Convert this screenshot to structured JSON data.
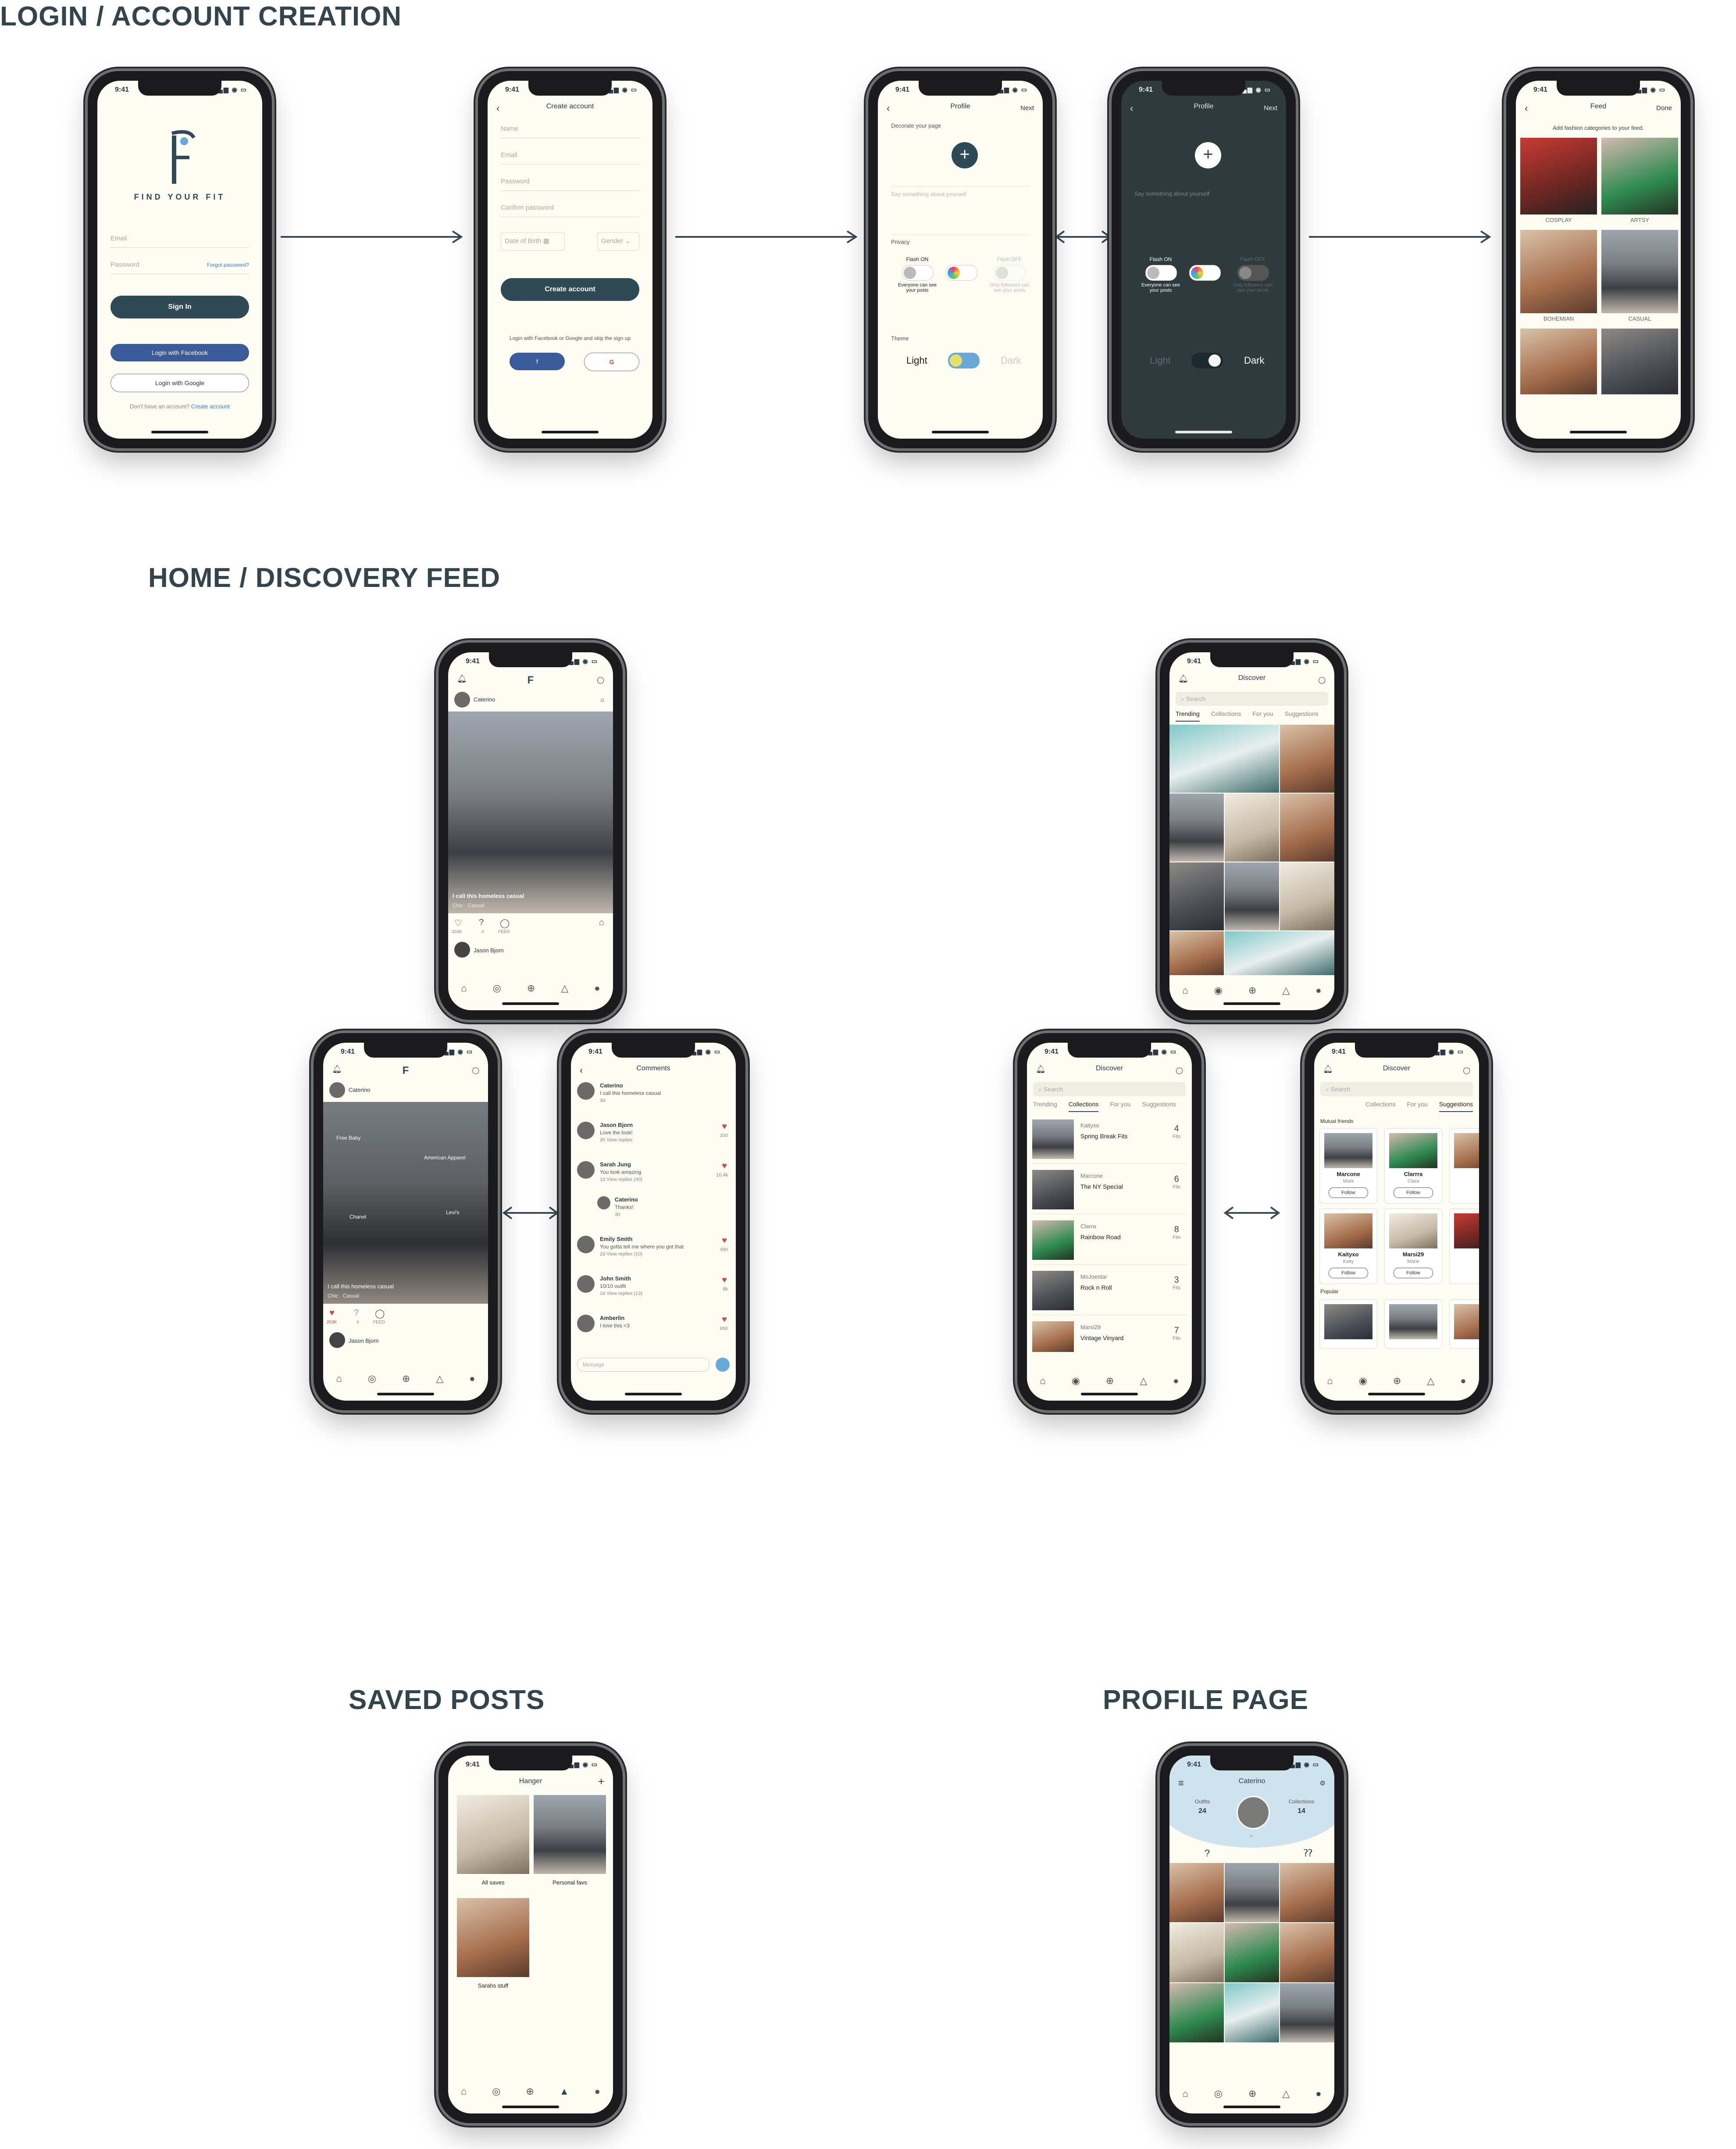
{
  "sections": {
    "login": "LOGIN / ACCOUNT CREATION",
    "home": "HOME / DISCOVERY FEED",
    "saved": "SAVED POSTS",
    "profile": "PROFILE PAGE"
  },
  "status_time": "9:41",
  "login": {
    "brand": "FIND YOUR FIT",
    "email_ph": "Email",
    "password_ph": "Password",
    "forgot": "Forgot password?",
    "sign_in": "Sign In",
    "facebook": "Login with Facebook",
    "google": "Login with Google",
    "no_account": "Don't have an account?",
    "create_link": "Create account"
  },
  "create": {
    "title": "Create account",
    "name": "Name",
    "email": "Email",
    "password": "Password",
    "confirm": "Confirm password",
    "dob": "Date of Birth",
    "gender": "Gender",
    "button": "Create account",
    "social_text": "Login with Facebook or Google and skip the sign up"
  },
  "profile_setup": {
    "title": "Profile",
    "next": "Next",
    "decorate": "Decorate your page",
    "bio_ph": "Say something about yourself",
    "privacy": "Privacy",
    "flash_on": "Flash ON",
    "flash_on_desc": "Everyone can see your posts",
    "flash_off": "Flash OFF",
    "flash_off_desc": "Only followers can see your posts",
    "theme": "Theme",
    "light": "Light",
    "dark": "Dark"
  },
  "feed_setup": {
    "title": "Feed",
    "done": "Done",
    "subtitle": "Add fashion categories to your feed.",
    "categories": [
      "COSPLAY",
      "ARTSY",
      "BOHEMIAN",
      "CASUAL"
    ]
  },
  "home": {
    "user": "Caterino",
    "caption": "I call this homeless casual",
    "tags": "Chic · Casual",
    "likes": "203K",
    "hangs": "4",
    "comments": "FEED",
    "next_user": "Jason Bjorn",
    "tag_labels": [
      "Free Baby",
      "American Apparel",
      "Chanel",
      "Levi's"
    ]
  },
  "comments": {
    "title": "Comments",
    "message_ph": "Message",
    "items": [
      {
        "name": "Caterino",
        "text": "I call this homeless casual",
        "meta": "3d",
        "count": ""
      },
      {
        "name": "Jason Bjorn",
        "text": "Love the look!",
        "meta": "3h  View replies",
        "count": "200"
      },
      {
        "name": "Sarah Jung",
        "text": "You look amazing",
        "meta": "1d  View replies (40)",
        "count": "10.4k"
      },
      {
        "name": "Caterino",
        "text": "Thanks!",
        "meta": "3h",
        "count": ""
      },
      {
        "name": "Emily Smith",
        "text": "You gotta tell me where you got that",
        "meta": "2d  View replies (10)",
        "count": "490"
      },
      {
        "name": "John Smith",
        "text": "10/10 outfit",
        "meta": "2d  View replies (13)",
        "count": "8k"
      },
      {
        "name": "Amberlin",
        "text": "I love this <3",
        "meta": "",
        "count": "690"
      }
    ]
  },
  "discover": {
    "title": "Discover",
    "search_ph": "Search",
    "tabs": [
      "Trending",
      "Collections",
      "For you",
      "Suggestions"
    ],
    "collections": [
      {
        "user": "Kaityxo",
        "title": "Spring Break Fits",
        "count": "4",
        "unit": "Fits"
      },
      {
        "user": "Marcone",
        "title": "The NY Special",
        "count": "6",
        "unit": "Fits"
      },
      {
        "user": "Clarra",
        "title": "Rainbow Road",
        "count": "8",
        "unit": "Fits"
      },
      {
        "user": "MoJoestar",
        "title": "Rock n Roll",
        "count": "3",
        "unit": "Fits"
      },
      {
        "user": "Marsi29",
        "title": "Vintage Vinyard",
        "count": "7",
        "unit": "Fits"
      }
    ],
    "mutual": "Mutual friends",
    "popular": "Popular",
    "follow": "Follow",
    "suggestions": [
      {
        "name": "Marcone",
        "sub": "Mark"
      },
      {
        "name": "Clarrra",
        "sub": "Clara"
      },
      {
        "name": "Kaityxo",
        "sub": "Kaity"
      },
      {
        "name": "Marsi29",
        "sub": "Marie"
      }
    ]
  },
  "saved": {
    "title": "Hanger",
    "add": "+",
    "folders": [
      "All saves",
      "Personal favs",
      "Sarahs stuff"
    ]
  },
  "profile": {
    "title": "Caterino",
    "outfits_label": "Outfits",
    "outfits": "24",
    "collections_label": "Collections",
    "collections": "14"
  }
}
